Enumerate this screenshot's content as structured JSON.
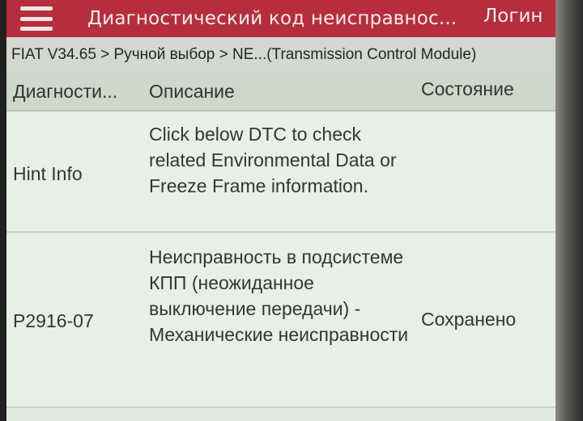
{
  "header": {
    "menu_icon": "hamburger-menu-icon",
    "title": "Диагностический код неисправнос...",
    "login_label": "Логин"
  },
  "breadcrumb": "FIAT V34.65 > Ручной выбор > NE...(Transmission Control Module)",
  "table": {
    "columns": [
      "Диагности...",
      "Описание",
      "Состояние"
    ],
    "rows": [
      {
        "code": "Hint Info",
        "description": "Click below DTC to check related Environmental Data or Freeze Frame information.",
        "state": ""
      },
      {
        "code": "P2916-07",
        "description": "Неисправность в подсистеме КПП (неожиданное выключение передачи) - Механические неисправности",
        "state": "Сохранено"
      }
    ]
  },
  "colors": {
    "header_bg": "#b62e3d",
    "breadcrumb_bg": "#d3d8d0",
    "row_bg": "#e8efe6"
  }
}
